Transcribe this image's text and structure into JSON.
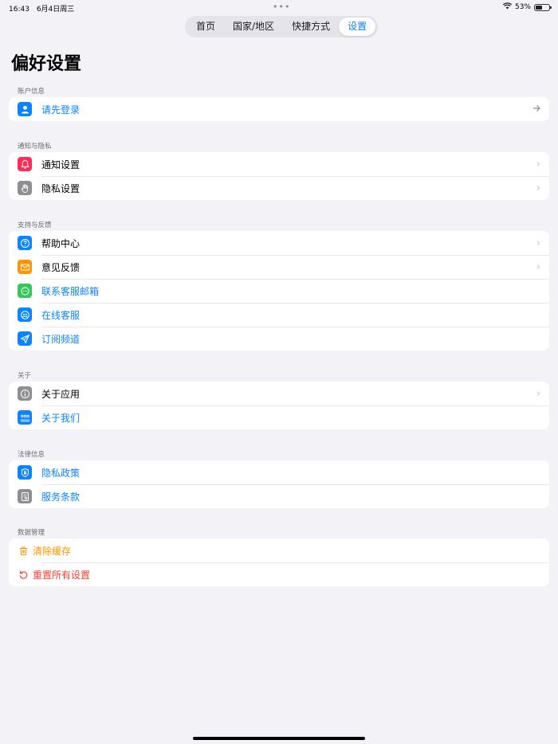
{
  "status": {
    "time": "16:43",
    "date": "6月4日周三",
    "battery": "53%",
    "battery_level": 0.53,
    "dots": "•••"
  },
  "tabs": [
    {
      "label": "首页"
    },
    {
      "label": "国家/地区"
    },
    {
      "label": "快捷方式"
    },
    {
      "label": "设置"
    }
  ],
  "page_title": "偏好设置",
  "sections": [
    {
      "header": "账户信息",
      "items": [
        {
          "label": "请先登录"
        }
      ]
    },
    {
      "header": "通知与隐私",
      "items": [
        {
          "label": "通知设置"
        },
        {
          "label": "隐私设置"
        }
      ]
    },
    {
      "header": "支持与反馈",
      "items": [
        {
          "label": "帮助中心"
        },
        {
          "label": "意见反馈"
        },
        {
          "label": "联系客服邮箱"
        },
        {
          "label": "在线客服"
        },
        {
          "label": "订阅频道"
        }
      ]
    },
    {
      "header": "关于",
      "items": [
        {
          "label": "关于应用"
        },
        {
          "label": "关于我们"
        }
      ]
    },
    {
      "header": "法律信息",
      "items": [
        {
          "label": "隐私政策"
        },
        {
          "label": "服务条款"
        }
      ]
    },
    {
      "header": "数据管理",
      "items": [
        {
          "label": "清除缓存"
        },
        {
          "label": "重置所有设置"
        }
      ]
    }
  ],
  "colors": {
    "accent": "#0a84ff",
    "red": "#ff3b30",
    "orange": "#ff9500",
    "green": "#34c759",
    "gray": "#8e8e93",
    "pink": "#ff2d55"
  }
}
